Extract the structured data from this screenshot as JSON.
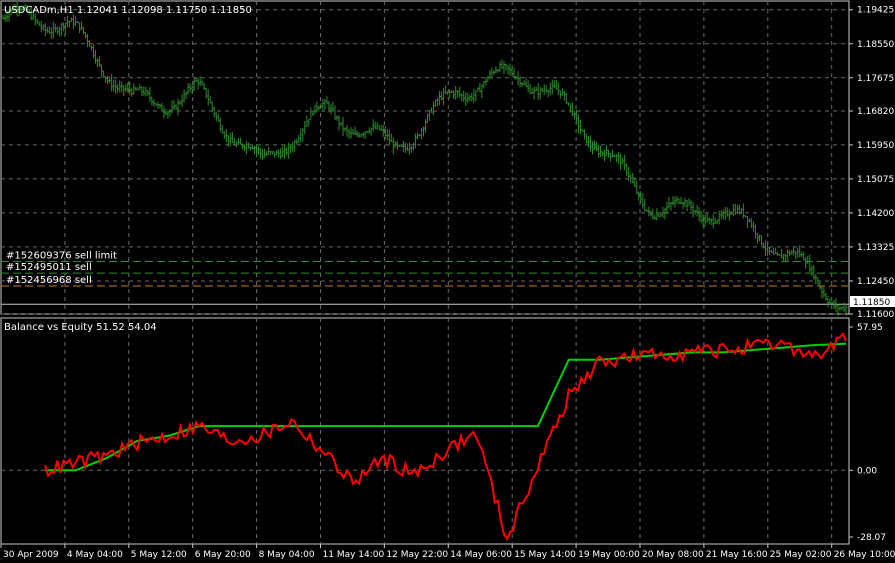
{
  "price_panel": {
    "header": "USDCADm,H1  1.12041 1.12098 1.11750 1.11850",
    "current_price_label": "1.11850",
    "y_ticks": [
      "1.19425",
      "1.18550",
      "1.17675",
      "1.16820",
      "1.15950",
      "1.15075",
      "1.14200",
      "1.13325",
      "1.12450",
      "1.11600"
    ],
    "orders": [
      {
        "label": "#152609376 sell limit",
        "price": 1.1295,
        "color": "#2e8b2e"
      },
      {
        "label": "#152495011 sell",
        "price": 1.1265,
        "color": "#2e8b2e"
      },
      {
        "label": "#152456968 sell",
        "price": 1.1232,
        "color": "#c8781e"
      }
    ]
  },
  "indicator_panel": {
    "header": "Balance vs Equity 51.52 54.04",
    "y_ticks": [
      "57.95",
      "0.00",
      "-28.07"
    ],
    "colors": {
      "balance": "#00d000",
      "equity": "#ff0000"
    }
  },
  "x_ticks": [
    "30 Apr 2009",
    "4 May 04:00",
    "5 May 12:00",
    "6 May 20:00",
    "8 May 04:00",
    "11 May 14:00",
    "12 May 22:00",
    "14 May 06:00",
    "15 May 14:00",
    "19 May 00:00",
    "20 May 08:00",
    "21 May 16:00",
    "25 May 02:00",
    "26 May 10:00"
  ],
  "chart_data": [
    {
      "type": "line",
      "title": "USDCADm,H1",
      "x": [
        "30 Apr 2009",
        "4 May 04:00",
        "5 May 12:00",
        "6 May 20:00",
        "8 May 04:00",
        "11 May 14:00",
        "12 May 22:00",
        "14 May 06:00",
        "15 May 14:00",
        "19 May 00:00",
        "20 May 08:00",
        "21 May 16:00",
        "25 May 02:00",
        "26 May 10:00"
      ],
      "series": [
        {
          "values": [
            1.192,
            1.186,
            1.172,
            1.177,
            1.152,
            1.165,
            1.162,
            1.176,
            1.174,
            1.162,
            1.148,
            1.143,
            1.128,
            1.1185
          ]
        }
      ],
      "ylim": [
        1.116,
        1.1965
      ]
    },
    {
      "type": "line",
      "title": "Balance vs Equity",
      "series": [
        {
          "name": "Balance",
          "values": [
            0,
            0,
            5,
            12,
            14,
            18,
            18,
            18,
            18,
            18,
            18,
            18,
            18,
            18,
            18,
            18,
            18,
            45,
            45,
            46,
            47,
            48,
            48,
            49,
            50,
            51,
            51.5
          ]
        },
        {
          "name": "Equity",
          "values": [
            0,
            3,
            6,
            11,
            14,
            18,
            12,
            14,
            20,
            8,
            -5,
            5,
            -2,
            8,
            15,
            -28,
            2,
            30,
            44,
            46,
            47,
            48,
            49,
            50,
            51,
            46,
            54.04
          ]
        }
      ],
      "ylim": [
        -30,
        62
      ]
    }
  ]
}
